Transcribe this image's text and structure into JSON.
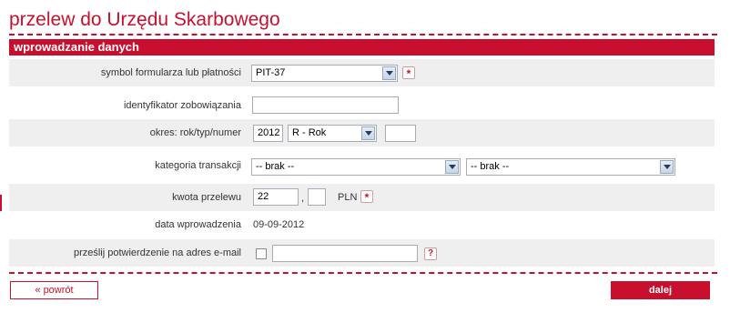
{
  "page": {
    "title": "przelew do Urzędu Skarbowego",
    "section_title": "wprowadzanie danych",
    "colors": {
      "accent": "#c8102e",
      "row_shade": "#efefef"
    }
  },
  "form": {
    "symbol": {
      "label": "symbol formularza lub płatności",
      "value": "PIT-37",
      "required_mark": "*"
    },
    "identyfikator": {
      "label": "identyfikator zobowiązania",
      "value": ""
    },
    "okres": {
      "label": "okres: rok/typ/numer",
      "year": "2012",
      "type": "R - Rok",
      "number": ""
    },
    "kategoria": {
      "label": "kategoria transakcji",
      "value1": "-- brak --",
      "value2": "-- brak --"
    },
    "kwota": {
      "label": "kwota przelewu",
      "whole": "22",
      "separator": ",",
      "fraction": "",
      "currency": "PLN",
      "required_mark": "*"
    },
    "data": {
      "label": "data wprowadzenia",
      "value": "09-09-2012"
    },
    "email": {
      "label": "prześlij potwierdzenie na adres e-mail",
      "value": "",
      "help": "?"
    }
  },
  "buttons": {
    "back": "« powrót",
    "next": "dalej"
  }
}
